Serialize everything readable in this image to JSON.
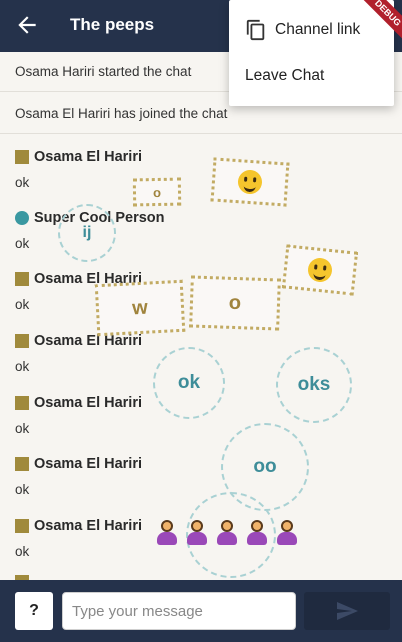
{
  "appbar": {
    "title": "The peeps",
    "debug_label": "DEBUG"
  },
  "menu": {
    "items": [
      {
        "label": "Channel link",
        "icon": "copy-icon"
      },
      {
        "label": "Leave Chat"
      }
    ]
  },
  "system_messages": [
    "Osama Hariri started the chat",
    "Osama El Hariri has joined the chat"
  ],
  "messages": [
    {
      "author": "Osama El Hariri",
      "text": "ok",
      "avatar": "square"
    },
    {
      "author": "Super Cool Person",
      "text": "ok",
      "avatar": "circle"
    },
    {
      "author": "Osama El Hariri",
      "text": "ok",
      "avatar": "square"
    },
    {
      "author": "Osama El Hariri",
      "text": "ok",
      "avatar": "square"
    },
    {
      "author": "Osama El Hariri",
      "text": "ok",
      "avatar": "square"
    },
    {
      "author": "Osama El Hariri",
      "text": "ok",
      "avatar": "square"
    },
    {
      "author": "Osama El Hariri",
      "text": "ok",
      "avatar": "square"
    }
  ],
  "reactions": {
    "rect_o_small": "o",
    "rect_w": "w",
    "rect_o": "o",
    "circle_ij": "ij",
    "circle_ok": "ok",
    "circle_oks": "oks",
    "circle_oo": "oo"
  },
  "composer": {
    "help_label": "?",
    "placeholder": "Type your message"
  },
  "colors": {
    "appbar": "#25324b",
    "avatar_gold": "#a08a3c",
    "avatar_teal": "#3a98a1",
    "background": "#f7f5f1"
  }
}
